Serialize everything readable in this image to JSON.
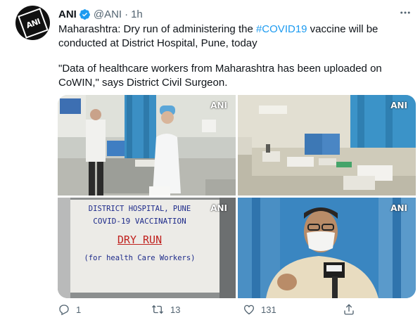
{
  "tweet": {
    "display_name": "ANI",
    "handle": "@ANI",
    "separator": "·",
    "time": "1h",
    "avatar_text": "ANI",
    "text_line1_prefix": "Maharashtra: Dry run of administering the ",
    "hashtag": "#COVID19",
    "text_line1_suffix": " vaccine will be conducted at District Hospital, Pune, today",
    "text_quote": "\"Data of healthcare workers from Maharashtra has been uploaded on CoWIN,\" says District Civil Surgeon."
  },
  "media": {
    "watermark": "ANI",
    "board": {
      "line1": "DISTRICT HOSPITAL, PUNE",
      "line2": "COVID-19 VACCINATION",
      "line3": "DRY RUN",
      "line4": "(for health Care Workers)"
    }
  },
  "actions": {
    "reply_count": "1",
    "retweet_count": "13",
    "like_count": "131"
  },
  "colors": {
    "accent": "#1d9bf0",
    "text": "#0f1419",
    "secondary": "#536471"
  },
  "icons": [
    "verified-badge-icon",
    "more-options-icon",
    "reply-icon",
    "retweet-icon",
    "like-icon",
    "share-icon"
  ]
}
